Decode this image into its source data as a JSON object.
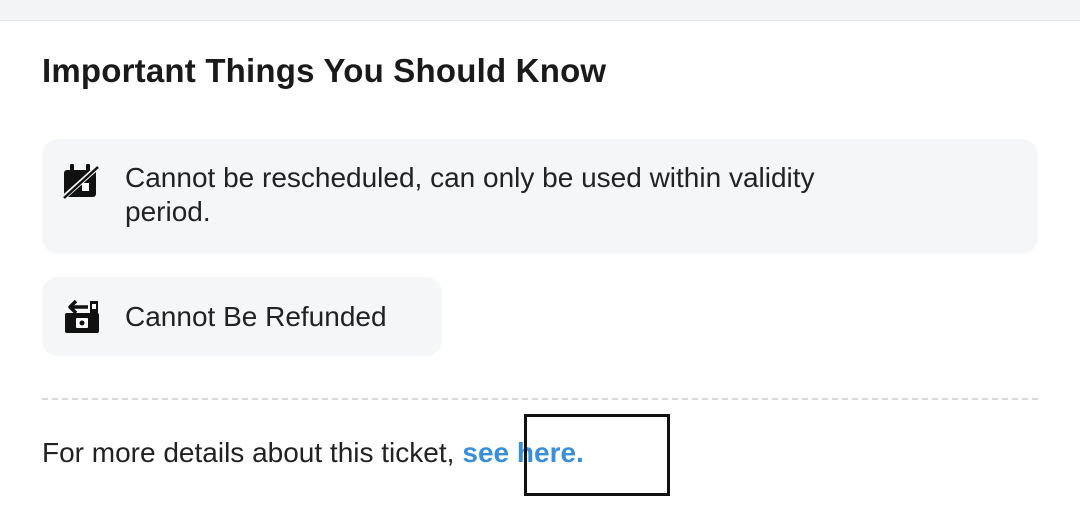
{
  "section": {
    "title": "Important Things You Should Know"
  },
  "notices": [
    {
      "icon": "calendar-slash-icon",
      "text": "Cannot be rescheduled, can only be used within validity period."
    },
    {
      "icon": "no-refund-icon",
      "text": "Cannot Be Refunded"
    }
  ],
  "footer": {
    "text": "For more details about this ticket,",
    "link_label": "see here.",
    "link_color": "#3a8fd6"
  }
}
